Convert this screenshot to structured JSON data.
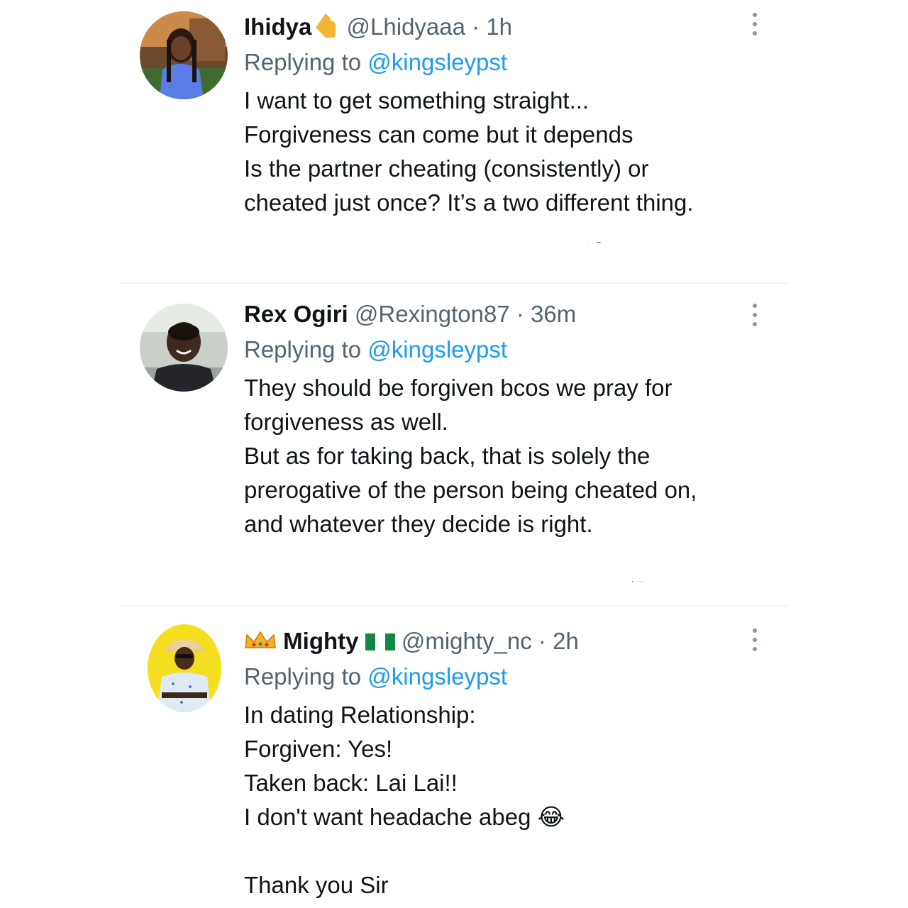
{
  "tweets": [
    {
      "name": "Ihidya",
      "name_badge": "label-tag-icon",
      "handle": "@Lhidyaaa",
      "separator": "·",
      "time": "1h",
      "replying_prefix": "Replying to",
      "replying_to": "@kingsleypst",
      "lines": [
        "I want to get something straight...",
        "Forgiveness can come but it depends",
        "Is the partner cheating (consistently) or",
        "cheated just once? It’s a two different thing."
      ]
    },
    {
      "name": "Rex Ogiri",
      "handle": "@Rexington87",
      "separator": "·",
      "time": "36m",
      "replying_prefix": "Replying to",
      "replying_to": "@kingsleypst",
      "lines": [
        "They should be forgiven bcos we pray for",
        "forgiveness as well.",
        "But as for taking back, that is solely the",
        "prerogative of the person being cheated on,",
        "and whatever they decide is right."
      ]
    },
    {
      "name": "Mighty",
      "name_prefix_badge": "crown-icon",
      "name_suffix_badge": "nigeria-flag-icon",
      "handle": "@mighty_nc",
      "separator": "·",
      "time": "2h",
      "replying_prefix": "Replying to",
      "replying_to": "@kingsleypst",
      "lines": [
        "In dating Relationship:",
        "Forgiven: Yes!",
        "Taken back: Lai Lai!!",
        "I don't want headache abeg 😂",
        "",
        "Thank you Sir"
      ]
    }
  ],
  "colors": {
    "text": "#0f1419",
    "secondary": "#536471",
    "link": "#1d9bf0",
    "divider": "#eff3f4"
  }
}
